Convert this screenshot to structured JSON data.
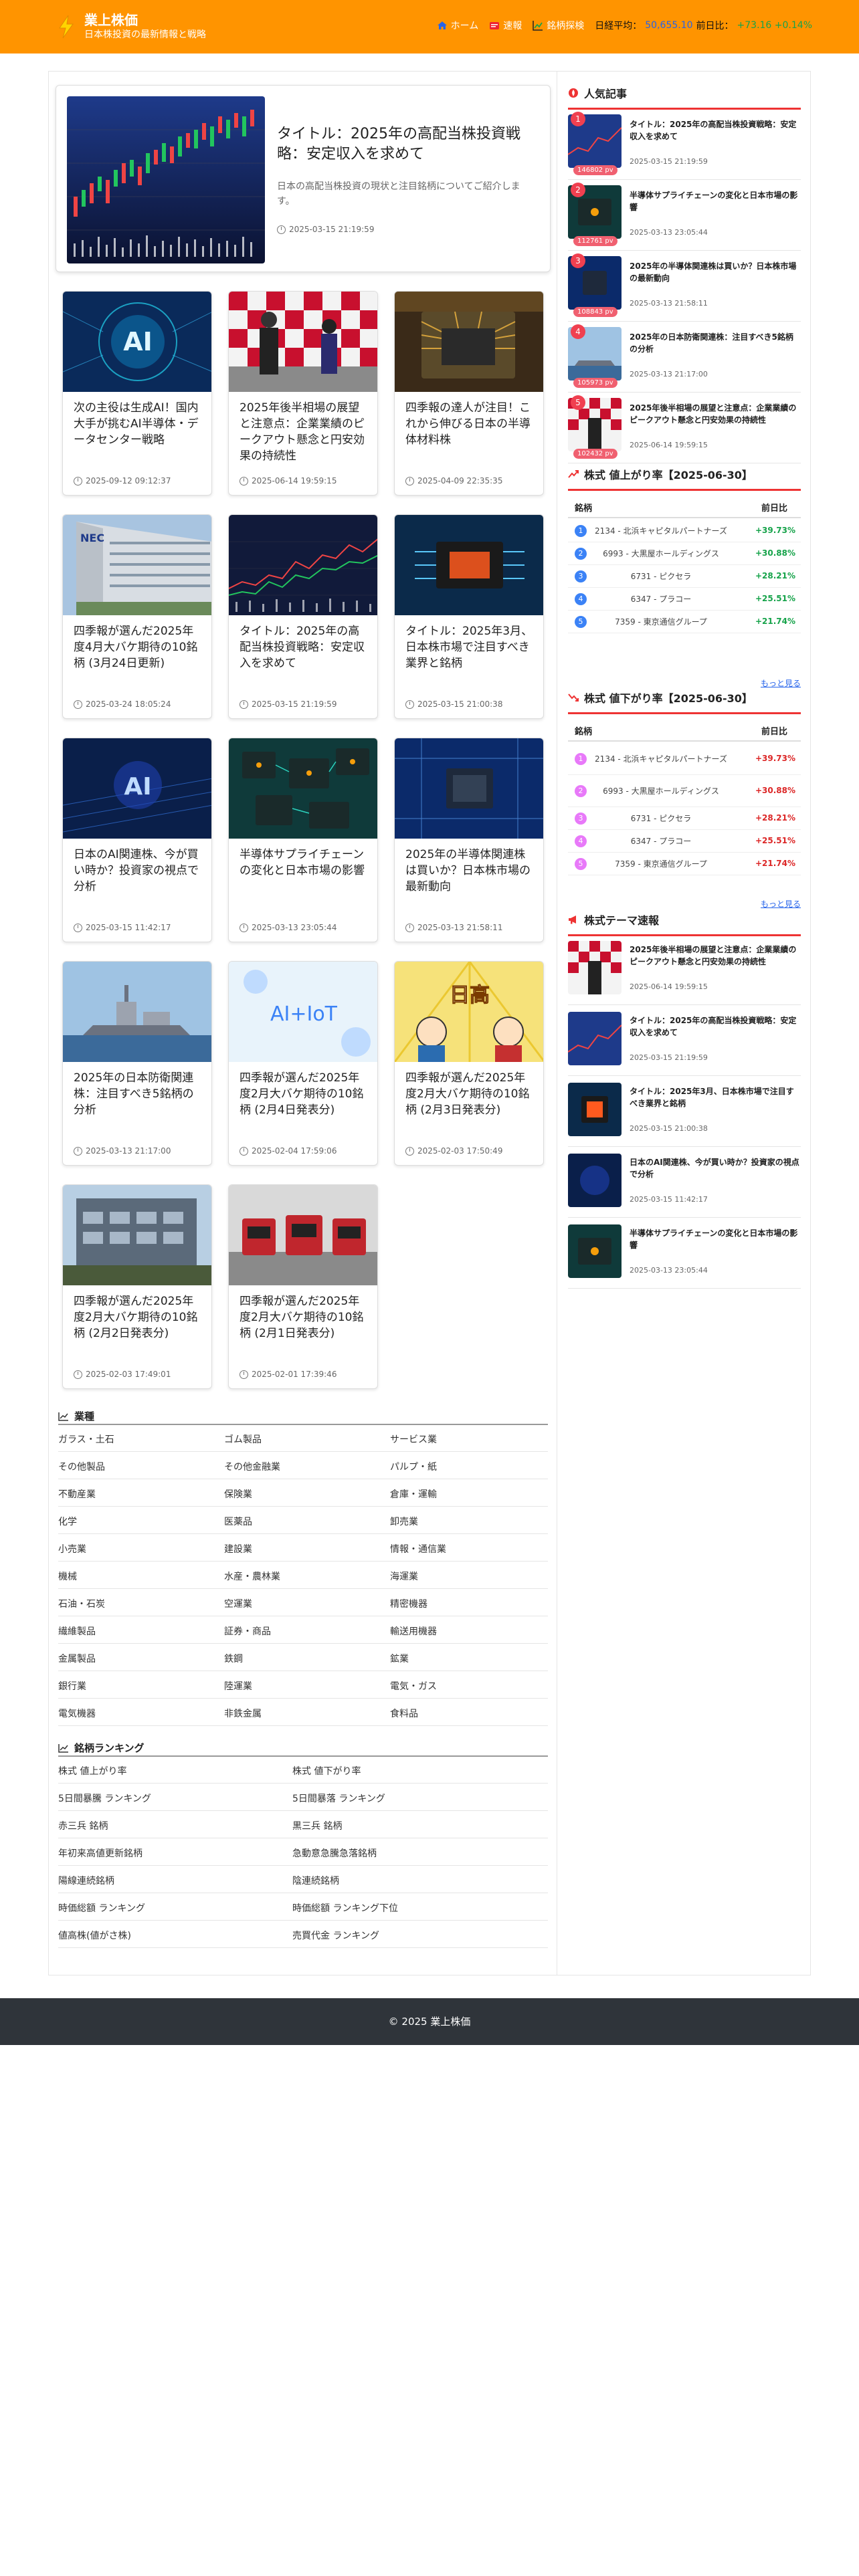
{
  "header": {
    "site_name": "業上株価",
    "site_sub": "日本株投資の最新情報と戦略",
    "nav": {
      "home": "ホーム",
      "news": "速報",
      "search": "銘柄探検",
      "nikkei_label": "日経平均：",
      "nikkei_value": "50,655.10",
      "change_label": "前日比：",
      "change_value": "+73.16 +0.14%"
    }
  },
  "featured": {
    "title": "タイトル：2025年の高配当株投資戦略：安定収入を求めて",
    "sub": "日本の高配当株投資の現状と注目銘柄についてご紹介します。",
    "date": "2025-03-15 21:19:59"
  },
  "cards": [
    {
      "title": "次の主役は生成AI！国内大手が挑むAI半導体・データセンター戦略",
      "date": "2025-09-12 09:12:37"
    },
    {
      "title": "2025年後半相場の展望と注意点：企業業績のピークアウト懸念と円安効果の持続性",
      "date": "2025-06-14 19:59:15"
    },
    {
      "title": "四季報の達人が注目！これから伸びる日本の半導体材料株",
      "date": "2025-04-09 22:35:35"
    },
    {
      "title": "四季報が選んだ2025年度4月大バケ期待の10銘柄 (3月24日更新)",
      "date": "2025-03-24 18:05:24"
    },
    {
      "title": "タイトル：2025年の高配当株投資戦略：安定収入を求めて",
      "date": "2025-03-15 21:19:59"
    },
    {
      "title": "タイトル：2025年3月、日本株市場で注目すべき業界と銘柄",
      "date": "2025-03-15 21:00:38"
    },
    {
      "title": "日本のAI関連株、今が買い時か？投資家の視点で分析",
      "date": "2025-03-15 11:42:17"
    },
    {
      "title": "半導体サプライチェーンの変化と日本市場の影響",
      "date": "2025-03-13 23:05:44"
    },
    {
      "title": "2025年の半導体関連株は買いか？日本株市場の最新動向",
      "date": "2025-03-13 21:58:11"
    },
    {
      "title": "2025年の日本防衛関連株：注目すべき5銘柄の分析",
      "date": "2025-03-13 21:17:00"
    },
    {
      "title": "四季報が選んだ2025年度2月大バケ期待の10銘柄 (2月4日発表分)",
      "date": "2025-02-04 17:59:06"
    },
    {
      "title": "四季報が選んだ2025年度2月大バケ期待の10銘柄 (2月3日発表分)",
      "date": "2025-02-03 17:50:49"
    },
    {
      "title": "四季報が選んだ2025年度2月大バケ期待の10銘柄 (2月2日発表分)",
      "date": "2025-02-03 17:49:01"
    },
    {
      "title": "四季報が選んだ2025年度2月大バケ期待の10銘柄 (2月1日発表分)",
      "date": "2025-02-01 17:39:46"
    }
  ],
  "images": {
    "ai_text": "AI",
    "aiot_text": "AI+IoT",
    "nec_text": "NEC",
    "manga_text": "日高"
  },
  "industries": {
    "heading": "業種",
    "items": [
      "ガラス・土石",
      "ゴム製品",
      "サービス業",
      "その他製品",
      "その他金融業",
      "パルプ・紙",
      "不動産業",
      "保険業",
      "倉庫・運輸",
      "化学",
      "医薬品",
      "卸売業",
      "小売業",
      "建設業",
      "情報・通信業",
      "機械",
      "水産・農林業",
      "海運業",
      "石油・石炭",
      "空運業",
      "精密機器",
      "繊維製品",
      "証券・商品",
      "輸送用機器",
      "金属製品",
      "鉄鋼",
      "鉱業",
      "銀行業",
      "陸運業",
      "電気・ガス",
      "電気機器",
      "非鉄金属",
      "食料品"
    ]
  },
  "rankings": {
    "heading": "銘柄ランキング",
    "items": [
      "株式 値上がり率",
      "株式 値下がり率",
      "5日間暴騰 ランキング",
      "5日間暴落 ランキング",
      "赤三兵 銘柄",
      "黒三兵 銘柄",
      "年初来高値更新銘柄",
      "急動意急騰急落銘柄",
      "陽線連続銘柄",
      "陰連続銘柄",
      "時価総額 ランキング",
      "時価総額 ランキング下位",
      "値高株(値がさ株)",
      "売買代金 ランキング"
    ]
  },
  "sidebar": {
    "popular_heading": "人気記事",
    "popular": [
      {
        "num": "1",
        "views": "146802 pv",
        "title": "タイトル：2025年の高配当株投資戦略：安定収入を求めて",
        "date": "2025-03-15 21:19:59"
      },
      {
        "num": "2",
        "views": "112761 pv",
        "title": "半導体サプライチェーンの変化と日本市場の影響",
        "date": "2025-03-13 23:05:44"
      },
      {
        "num": "3",
        "views": "108843 pv",
        "title": "2025年の半導体関連株は買いか？日本株市場の最新動向",
        "date": "2025-03-13 21:58:11"
      },
      {
        "num": "4",
        "views": "105973 pv",
        "title": "2025年の日本防衛関連株：注目すべき5銘柄の分析",
        "date": "2025-03-13 21:17:00"
      },
      {
        "num": "5",
        "views": "102432 pv",
        "title": "2025年後半相場の展望と注意点：企業業績のピークアウト懸念と円安効果の持続性",
        "date": "2025-06-14 19:59:15"
      }
    ],
    "up_heading": "株式 値上がり率【2025-06-30】",
    "down_heading": "株式 値下がり率【2025-06-30】",
    "col_name": "銘柄",
    "col_change": "前日比",
    "up": [
      {
        "num": "1",
        "name": "2134 - 北浜キャピタルパートナーズ",
        "pct": "+39.73%"
      },
      {
        "num": "2",
        "name": "6993 - 大黒屋ホールディングス",
        "pct": "+30.88%"
      },
      {
        "num": "3",
        "name": "6731 - ピクセラ",
        "pct": "+28.21%"
      },
      {
        "num": "4",
        "name": "6347 - プラコー",
        "pct": "+25.51%"
      },
      {
        "num": "5",
        "name": "7359 - 東京通信グループ",
        "pct": "+21.74%"
      }
    ],
    "down": [
      {
        "num": "1",
        "name": "2134 - 北浜キャピタルパートナーズ",
        "pct": "+39.73%"
      },
      {
        "num": "2",
        "name": "6993 - 大黒屋ホールディングス",
        "pct": "+30.88%"
      },
      {
        "num": "3",
        "name": "6731 - ピクセラ",
        "pct": "+28.21%"
      },
      {
        "num": "4",
        "name": "6347 - プラコー",
        "pct": "+25.51%"
      },
      {
        "num": "5",
        "name": "7359 - 東京通信グループ",
        "pct": "+21.74%"
      }
    ],
    "more": "もっと見る",
    "theme_heading": "株式テーマ速報",
    "themes": [
      {
        "title": "2025年後半相場の展望と注意点：企業業績のピークアウト懸念と円安効果の持続性",
        "date": "2025-06-14 19:59:15"
      },
      {
        "title": "タイトル：2025年の高配当株投資戦略：安定収入を求めて",
        "date": "2025-03-15 21:19:59"
      },
      {
        "title": "タイトル：2025年3月、日本株市場で注目すべき業界と銘柄",
        "date": "2025-03-15 21:00:38"
      },
      {
        "title": "日本のAI関連株、今が買い時か？投資家の視点で分析",
        "date": "2025-03-15 11:42:17"
      },
      {
        "title": "半導体サプライチェーンの変化と日本市場の影響",
        "date": "2025-03-13 23:05:44"
      }
    ]
  },
  "colors": {
    "header": "#ff9400",
    "up": "#16a34a",
    "down": "#dc2626",
    "rank_up": "#3b82f6",
    "rank_down": "#e879f9"
  },
  "footer": "© 2025 業上株価"
}
